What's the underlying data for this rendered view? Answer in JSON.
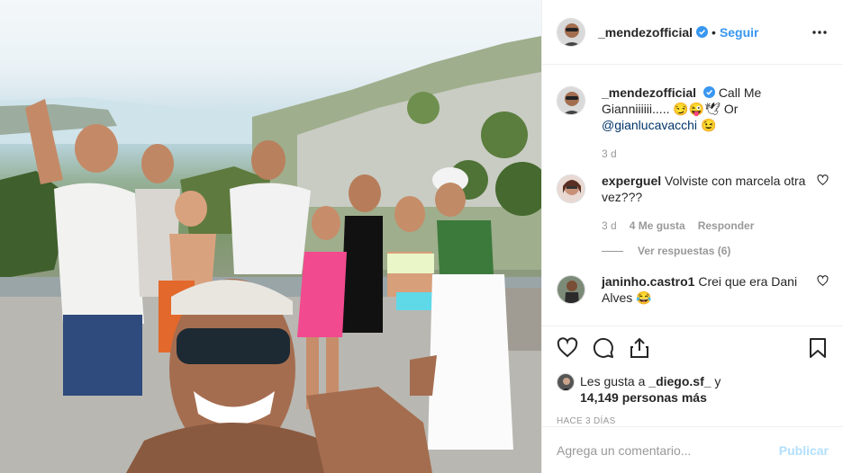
{
  "post": {
    "author": "_mendezofficial",
    "follow_label": "Seguir",
    "dot": "•",
    "caption_author": "_mendezofficial",
    "caption_text": "Call Me Gianniiiiii..... 😏😜🕊 Or",
    "caption_mention": "@gianlucavacchi",
    "caption_emoji": "😉",
    "caption_time": "3 d"
  },
  "comments": [
    {
      "user": "experguel",
      "text": "Volviste con marcela otra vez???",
      "time": "3 d",
      "likes": "4 Me gusta",
      "reply_label": "Responder",
      "view_replies": "Ver respuestas (6)"
    },
    {
      "user": "janinho.castro1",
      "text": "Crei que era Dani Alves 😂"
    }
  ],
  "likes": {
    "prefix": "Les gusta a",
    "first_user": "_diego.sf_",
    "joiner": "y",
    "count_text": "14,149 personas más"
  },
  "timestamp": "HACE 3 DÍAS",
  "add_comment": {
    "placeholder": "Agrega un comentario...",
    "publish_label": "Publicar"
  },
  "colors": {
    "link": "#3897f0",
    "mention": "#003569",
    "muted": "#999999",
    "publish_disabled": "#b2dffc"
  }
}
